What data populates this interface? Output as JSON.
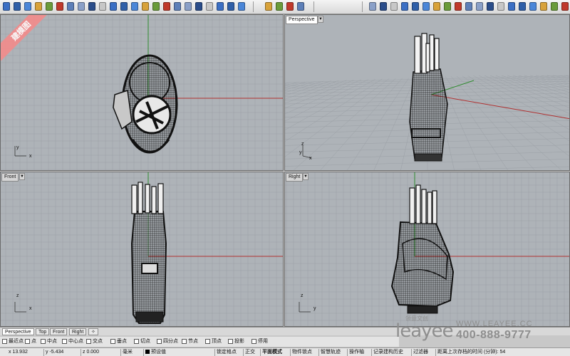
{
  "watermark": {
    "text": "建模图"
  },
  "viewports": {
    "top": {
      "label": ""
    },
    "perspective": {
      "label": "Perspective"
    },
    "front": {
      "label": "Front"
    },
    "right": {
      "label": "Right"
    }
  },
  "axis": {
    "x": "x",
    "y": "y",
    "z": "z"
  },
  "tabs": [
    {
      "label": "Perspective",
      "active": true
    },
    {
      "label": "Top"
    },
    {
      "label": "Front"
    },
    {
      "label": "Right"
    },
    {
      "label": "✧"
    }
  ],
  "osnaps": [
    {
      "label": "最近点",
      "checked": false
    },
    {
      "label": "点",
      "checked": false
    },
    {
      "label": "中点",
      "checked": false
    },
    {
      "label": "中心点",
      "checked": false
    },
    {
      "label": "交点",
      "checked": false
    },
    {
      "label": "垂点",
      "checked": false
    },
    {
      "label": "切点",
      "checked": false
    },
    {
      "label": "四分点",
      "checked": false
    },
    {
      "label": "节点",
      "checked": false
    },
    {
      "label": "顶点",
      "checked": false
    },
    {
      "label": "投影",
      "checked": false
    },
    {
      "label": "停用",
      "checked": false
    }
  ],
  "status": {
    "x": "x 13.932",
    "y": "y -5.434",
    "z": "z 0.000",
    "units": "毫米",
    "layer": "预设值",
    "lock_grid": "锁定格点",
    "ortho": "正交",
    "planar": "平面模式",
    "osnap": "物件锁点",
    "smarttrack": "智慧轨迹",
    "gumball": "操作轴",
    "history": "记录建构历史",
    "filter": "过滤器",
    "autosave": "距离上次存档的时间 (分钟): 54"
  },
  "brand": {
    "logo": "leayee",
    "cn": "领意文创",
    "url": "WWW.LEAYEE.CC",
    "phone": "400-888-9777"
  },
  "colors": {
    "viewport_bg": "#aeb3b8",
    "grid_line": "#9ba0a6",
    "axis_x": "#b03030",
    "axis_y": "#2e8b2e",
    "wire": "#111111",
    "watermark": "#f28c8c",
    "brand_text": "#8e8e8e"
  }
}
